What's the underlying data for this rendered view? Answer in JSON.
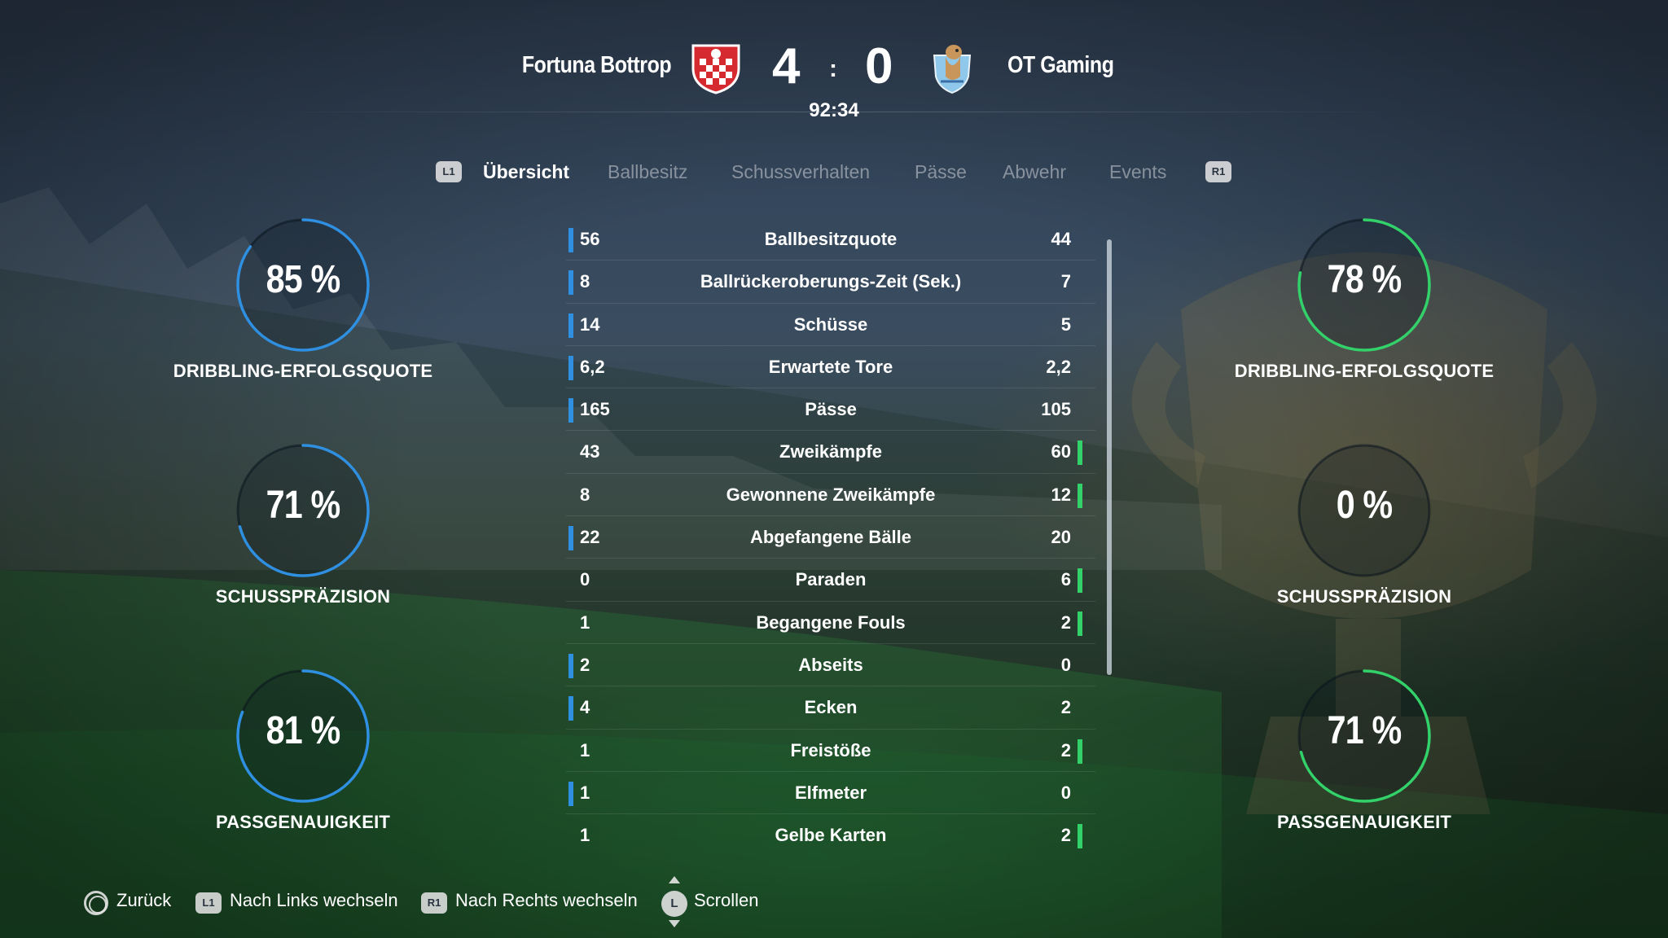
{
  "header": {
    "home_team": "Fortuna Bottrop",
    "away_team": "OT Gaming",
    "home_score": "4",
    "away_score": "0",
    "score_separator": ":",
    "clock": "92:34"
  },
  "tabs": {
    "left_hint": "L1",
    "right_hint": "R1",
    "items": [
      "Übersicht",
      "Ballbesitz",
      "Schussverhalten",
      "Pässe",
      "Abwehr",
      "Events"
    ],
    "active": "Übersicht"
  },
  "home_rings": [
    {
      "value": "85 %",
      "label": "DRIBBLING-ERFOLGSQUOTE",
      "fraction": 0.85,
      "color": "#2f8fe0"
    },
    {
      "value": "71 %",
      "label": "SCHUSSPRÄZISION",
      "fraction": 0.71,
      "color": "#2f8fe0"
    },
    {
      "value": "81 %",
      "label": "PASSGENAUIGKEIT",
      "fraction": 0.81,
      "color": "#2f8fe0"
    }
  ],
  "away_rings": [
    {
      "value": "78 %",
      "label": "DRIBBLING-ERFOLGSQUOTE",
      "fraction": 0.78,
      "color": "#33d16a"
    },
    {
      "value": "0 %",
      "label": "SCHUSSPRÄZISION",
      "fraction": 0.0,
      "color": "#33d16a"
    },
    {
      "value": "71 %",
      "label": "PASSGENAUIGKEIT",
      "fraction": 0.71,
      "color": "#33d16a"
    }
  ],
  "stats": [
    {
      "home": "56",
      "label": "Ballbesitzquote",
      "away": "44",
      "leader": "home"
    },
    {
      "home": "8",
      "label": "Ballrückeroberungs-Zeit (Sek.)",
      "away": "7",
      "leader": "home"
    },
    {
      "home": "14",
      "label": "Schüsse",
      "away": "5",
      "leader": "home"
    },
    {
      "home": "6,2",
      "label": "Erwartete Tore",
      "away": "2,2",
      "leader": "home"
    },
    {
      "home": "165",
      "label": "Pässe",
      "away": "105",
      "leader": "home"
    },
    {
      "home": "43",
      "label": "Zweikämpfe",
      "away": "60",
      "leader": "away"
    },
    {
      "home": "8",
      "label": "Gewonnene Zweikämpfe",
      "away": "12",
      "leader": "away"
    },
    {
      "home": "22",
      "label": "Abgefangene Bälle",
      "away": "20",
      "leader": "home"
    },
    {
      "home": "0",
      "label": "Paraden",
      "away": "6",
      "leader": "away"
    },
    {
      "home": "1",
      "label": "Begangene Fouls",
      "away": "2",
      "leader": "away"
    },
    {
      "home": "2",
      "label": "Abseits",
      "away": "0",
      "leader": "home"
    },
    {
      "home": "4",
      "label": "Ecken",
      "away": "2",
      "leader": "home"
    },
    {
      "home": "1",
      "label": "Freistöße",
      "away": "2",
      "leader": "away"
    },
    {
      "home": "1",
      "label": "Elfmeter",
      "away": "0",
      "leader": "home"
    },
    {
      "home": "1",
      "label": "Gelbe Karten",
      "away": "2",
      "leader": "away"
    }
  ],
  "footer": {
    "back": "Zurück",
    "l1_hint": "L1",
    "switch_left": "Nach Links wechseln",
    "r1_hint": "R1",
    "switch_right": "Nach Rechts wechseln",
    "stick_hint": "L",
    "scroll": "Scrollen"
  },
  "icons": {
    "home_crest": "fortuna-bottrop-crest-icon",
    "away_crest": "ot-gaming-crest-icon",
    "back_button": "circle-button-icon",
    "stick": "left-stick-icon"
  },
  "colors": {
    "home_accent": "#2f8fe0",
    "away_accent": "#33d16a",
    "ring_track": "#1f2c3a"
  }
}
